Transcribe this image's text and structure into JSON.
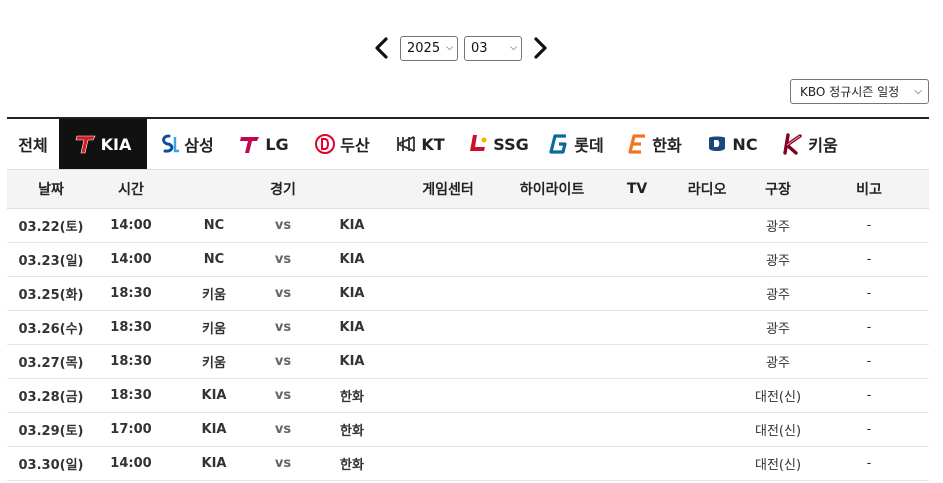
{
  "date_nav": {
    "year": "2025",
    "month": "03",
    "prev_icon": "chevron-left-icon",
    "next_icon": "chevron-right-icon"
  },
  "season_select": {
    "value": "KBO 정규시즌 일정"
  },
  "teams": {
    "all": "전체",
    "items": [
      {
        "name": "KIA",
        "color": "#d71920",
        "mono": "T"
      },
      {
        "name": "삼성",
        "color": "#0a4fa0",
        "mono": "SL"
      },
      {
        "name": "LG",
        "color": "#c30452",
        "mono": "T"
      },
      {
        "name": "두산",
        "color": "#e4002b",
        "mono": "D"
      },
      {
        "name": "KT",
        "color": "#333333",
        "mono": "K"
      },
      {
        "name": "SSG",
        "color": "#ce0e2d",
        "mono": "L"
      },
      {
        "name": "롯데",
        "color": "#0a6a9e",
        "mono": "G"
      },
      {
        "name": "한화",
        "color": "#f37321",
        "mono": "E"
      },
      {
        "name": "NC",
        "color": "#1d467f",
        "mono": "D"
      },
      {
        "name": "키움",
        "color": "#820024",
        "mono": "K"
      }
    ],
    "active_index": 0
  },
  "table": {
    "headers": [
      "날짜",
      "시간",
      "경기",
      "게임센터",
      "하이라이트",
      "TV",
      "라디오",
      "구장",
      "비고"
    ],
    "rows": [
      {
        "date": "03.22(토)",
        "time": "14:00",
        "away": "NC",
        "vs": "vs",
        "home": "KIA",
        "venue": "광주",
        "note": "-"
      },
      {
        "date": "03.23(일)",
        "time": "14:00",
        "away": "NC",
        "vs": "vs",
        "home": "KIA",
        "venue": "광주",
        "note": "-"
      },
      {
        "date": "03.25(화)",
        "time": "18:30",
        "away": "키움",
        "vs": "vs",
        "home": "KIA",
        "venue": "광주",
        "note": "-"
      },
      {
        "date": "03.26(수)",
        "time": "18:30",
        "away": "키움",
        "vs": "vs",
        "home": "KIA",
        "venue": "광주",
        "note": "-"
      },
      {
        "date": "03.27(목)",
        "time": "18:30",
        "away": "키움",
        "vs": "vs",
        "home": "KIA",
        "venue": "광주",
        "note": "-"
      },
      {
        "date": "03.28(금)",
        "time": "18:30",
        "away": "KIA",
        "vs": "vs",
        "home": "한화",
        "venue": "대전(신)",
        "note": "-"
      },
      {
        "date": "03.29(토)",
        "time": "17:00",
        "away": "KIA",
        "vs": "vs",
        "home": "한화",
        "venue": "대전(신)",
        "note": "-"
      },
      {
        "date": "03.30(일)",
        "time": "14:00",
        "away": "KIA",
        "vs": "vs",
        "home": "한화",
        "venue": "대전(신)",
        "note": "-"
      }
    ]
  }
}
